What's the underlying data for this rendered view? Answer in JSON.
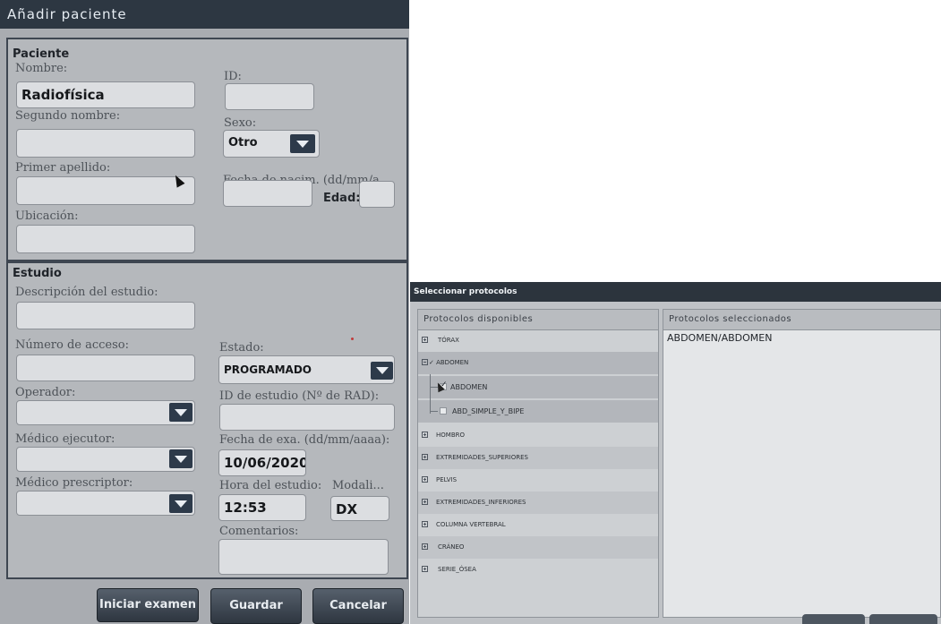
{
  "dialog": {
    "title": "Añadir paciente",
    "paciente": {
      "section": "Paciente",
      "nombre_label": "Nombre:",
      "nombre_value": "Radiofísica",
      "id_label": "ID:",
      "id_value": "",
      "segundo_nombre_label": "Segundo nombre:",
      "sexo_label": "Sexo:",
      "sexo_value": "Otro",
      "primer_apellido_label": "Primer apellido:",
      "fecha_nac_label": "Fecha de nacim. (dd/mm/a...",
      "edad_label": "Edad:",
      "ubicacion_label": "Ubicación:"
    },
    "estudio": {
      "section": "Estudio",
      "descripcion_label": "Descripción del estudio:",
      "acceso_label": "Número de acceso:",
      "estado_label": "Estado:",
      "estado_value": "PROGRAMADO",
      "operador_label": "Operador:",
      "id_estudio_label": "ID de estudio (Nº de RAD):",
      "medico_ejecutor_label": "Médico ejecutor:",
      "fecha_exa_label": "Fecha de exa. (dd/mm/aaaa):",
      "fecha_exa_value": "10/06/2020",
      "medico_prescriptor_label": "Médico prescriptor:",
      "hora_label": "Hora del estudio:",
      "hora_value": "12:53",
      "modalidad_label": "Modali...",
      "modalidad_value": "DX",
      "comentarios_label": "Comentarios:"
    },
    "buttons": {
      "iniciar": "Iniciar examen",
      "guardar": "Guardar",
      "cancelar": "Cancelar"
    }
  },
  "protocol_window": {
    "title": "Seleccionar protocolos",
    "available_header": "Protocolos disponibles",
    "selected_header": "Protocolos seleccionados",
    "items": [
      {
        "label": "TÓRAX"
      },
      {
        "label": "✓ ABDOMEN"
      },
      {
        "label": "ABDOMEN"
      },
      {
        "label": "ABD_SIMPLE_Y_BIPE"
      },
      {
        "label": "HOMBRO"
      },
      {
        "label": "EXTREMIDADES_SUPERIORES"
      },
      {
        "label": "PELVIS"
      },
      {
        "label": "EXTREMIDADES_INFERIORES"
      },
      {
        "label": "COLUMNA VERTEBRAL"
      },
      {
        "label": "CRÁNEO"
      },
      {
        "label": "SERIE_ÓSEA"
      }
    ],
    "selected": [
      "ABDOMEN/ABDOMEN"
    ]
  }
}
